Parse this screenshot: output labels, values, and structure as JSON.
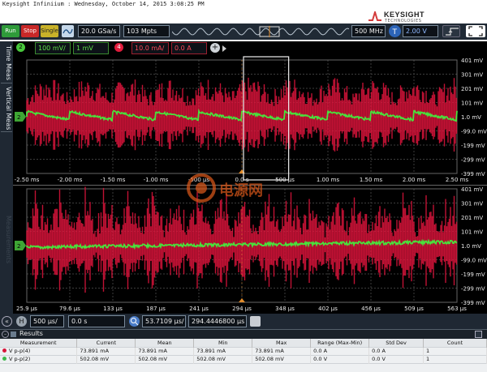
{
  "window": {
    "title": "Keysight Infiniium : Wednesday, October 14, 2015 3:08:25 PM"
  },
  "logo": {
    "name": "KEYSIGHT",
    "sub": "TECHNOLOGIES"
  },
  "controls": {
    "run": "Run",
    "stop": "Stop",
    "single": "Single",
    "sample_rate": "20.0 GSa/s",
    "memory_depth": "103 Mpts",
    "bandwidth": "500 MHz",
    "trigger_level": "2.00 V"
  },
  "channels": {
    "ch2_badge": "2",
    "ch2_scale": "100 mV/",
    "ch2_offset": "1 mV",
    "ch4_badge": "4",
    "ch4_scale": "10.0 mA/",
    "ch4_offset": "0.0 A"
  },
  "sidebar": {
    "time_meas": "Time Meas",
    "vertical_meas": "Vertical Meas",
    "measurements": "Measurements"
  },
  "upper_panel": {
    "y_ticks": [
      "401 mV",
      "301 mV",
      "201 mV",
      "101 mV",
      "1.0 mV",
      "-99.0 mV",
      "-199 mV",
      "-299 mV",
      "-399 mV"
    ],
    "x_ticks": [
      "-2.50 ms",
      "-2.00 ms",
      "-1.50 ms",
      "-1.00 ms",
      "-500 µs",
      "0.0 s",
      "500 µs",
      "1.00 ms",
      "1.50 ms",
      "2.00 ms",
      "2.50 ms"
    ],
    "channel_marker": "2"
  },
  "lower_panel": {
    "y_ticks": [
      "401 mV",
      "301 mV",
      "201 mV",
      "101 mV",
      "1.0 mV",
      "-99.0 mV",
      "-199 mV",
      "-299 mV",
      "-399 mV"
    ],
    "x_ticks": [
      "25.9 µs",
      "79.6 µs",
      "133 µs",
      "187 µs",
      "241 µs",
      "294 µs",
      "348 µs",
      "402 µs",
      "456 µs",
      "509 µs",
      "563 µs"
    ],
    "channel_marker": "2"
  },
  "watermark": "电源网",
  "horizontal": {
    "badge": "H",
    "timebase": "500 µs/",
    "position": "0.0 s",
    "zoom_scale": "53.7109 µs/",
    "zoom_position": "294.4446800 µs"
  },
  "results": {
    "title": "Results",
    "headers": [
      "Measurement",
      "Current",
      "Mean",
      "Min",
      "Max",
      "Range (Max-Min)",
      "Std Dev",
      "Count"
    ],
    "rows": [
      {
        "color": "#d8163a",
        "cells": [
          "V p-p(4)",
          "73.891 mA",
          "73.891 mA",
          "73.891 mA",
          "73.891 mA",
          "0.0 A",
          "0.0 A",
          "1"
        ]
      },
      {
        "color": "#3cb84a",
        "cells": [
          "V p-p(2)",
          "502.08 mV",
          "502.08 mV",
          "502.08 mV",
          "502.08 mV",
          "0.0 V",
          "0.0 V",
          "1"
        ]
      }
    ]
  },
  "colors": {
    "ch2": "#48e23c",
    "ch4": "#e0143c",
    "bar": "#1f2833",
    "accent": "#d33b3b"
  }
}
